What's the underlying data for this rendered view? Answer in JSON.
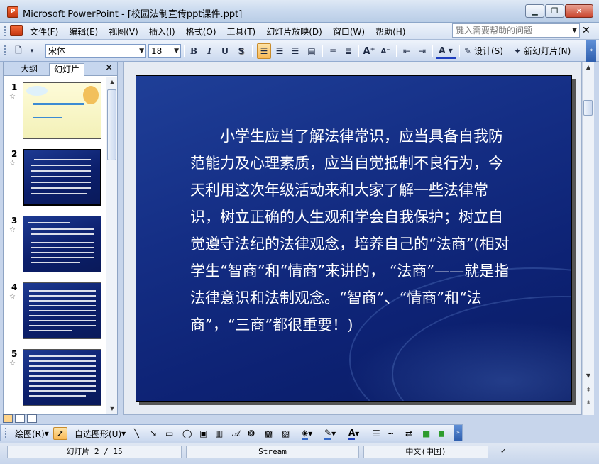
{
  "window": {
    "title": "Microsoft PowerPoint - [校园法制宣传ppt课件.ppt]",
    "app_icon_label": "P"
  },
  "menu": {
    "items": [
      "文件(F)",
      "编辑(E)",
      "视图(V)",
      "插入(I)",
      "格式(O)",
      "工具(T)",
      "幻灯片放映(D)",
      "窗口(W)",
      "帮助(H)"
    ],
    "help_placeholder": "键入需要帮助的问题"
  },
  "toolbar": {
    "font_name": "宋体",
    "font_size": "18",
    "bold": "B",
    "italic": "I",
    "underline": "U",
    "shadow": "S",
    "design_label": "设计(S)",
    "new_slide_label": "新幻灯片(N)"
  },
  "left_pane": {
    "tab_outline": "大纲",
    "tab_slides": "幻灯片",
    "close": "×",
    "thumbnails": [
      {
        "num": "1"
      },
      {
        "num": "2"
      },
      {
        "num": "3"
      },
      {
        "num": "4"
      },
      {
        "num": "5"
      }
    ]
  },
  "slide": {
    "body_text": "小学生应当了解法律常识，应当具备自我防范能力及心理素质，应当自觉抵制不良行为，今天利用这次年级活动来和大家了解一些法律常识，树立正确的人生观和学会自我保护；树立自觉遵守法纪的法律观念，培养自己的“法商”(相对学生“智商”和“情商”来讲的， “法商”——就是指法律意识和法制观念。“智商”、“情商”和“法商”，“三商”都很重要！)"
  },
  "draw_toolbar": {
    "draw_label": "绘图(R)",
    "autoshapes_label": "自选图形(U)"
  },
  "status": {
    "slide_indicator": "幻灯片 2 / 15",
    "design_name": "Stream",
    "language": "中文(中国)"
  },
  "colors": {
    "slide_bg": "#152f86",
    "slide_text": "#ffffff",
    "accent_orange": "#f9b956"
  }
}
